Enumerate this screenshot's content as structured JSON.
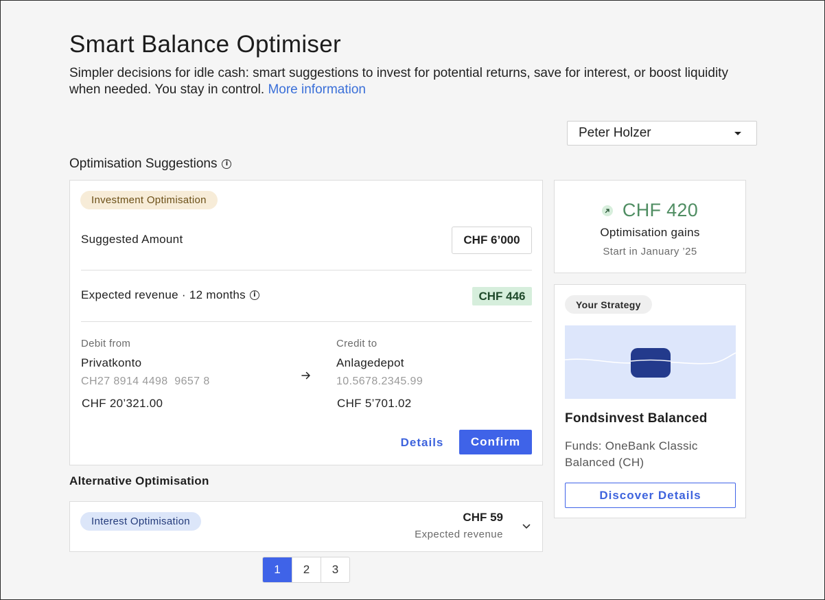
{
  "page": {
    "title": "Smart Balance Optimiser",
    "intro": "Simpler decisions for idle cash: smart suggestions to invest for potential returns, save for interest, or boost liquidity when needed. You stay in control.",
    "more_info_link": "More information"
  },
  "user_select": {
    "selected": "Peter Holzer"
  },
  "suggestions": {
    "section_title": "Optimisation Suggestions",
    "tag": "Investment Optimisation",
    "suggested_amount_label": "Suggested Amount",
    "suggested_amount_value": "CHF 6’000",
    "expected_revenue_label": "Expected revenue · 12 months",
    "expected_revenue_value": "CHF 446",
    "debit": {
      "label": "Debit from",
      "account_name": "Privatkonto",
      "iban": "CH27 8914 4498  9657 8",
      "balance": "CHF 20’321.00"
    },
    "credit": {
      "label": "Credit to",
      "account_name": "Anlagedepot",
      "number": "10.5678.2345.99",
      "balance": "CHF 5’701.02"
    },
    "details_button": "Details",
    "confirm_button": "Confirm"
  },
  "alternative": {
    "title": "Alternative Optimisation",
    "tag": "Interest Optimisation",
    "amount": "CHF 59",
    "amount_label": "Expected revenue"
  },
  "pagination": {
    "pages": [
      "1",
      "2",
      "3"
    ],
    "active": "1"
  },
  "gains": {
    "value": "CHF 420",
    "label": "Optimisation gains",
    "sub": "Start in January ’25"
  },
  "strategy": {
    "tag": "Your Strategy",
    "name": "Fondsinvest Balanced",
    "description": "Funds: OneBank Classic Balanced (CH)",
    "button": "Discover Details"
  },
  "colors": {
    "accent": "#3f63e8",
    "gain_green": "#4f8d62",
    "invest_tag_bg": "#f7ecd8",
    "interest_tag_bg": "#dce6f9",
    "revenue_badge_bg": "#d6eedc"
  }
}
